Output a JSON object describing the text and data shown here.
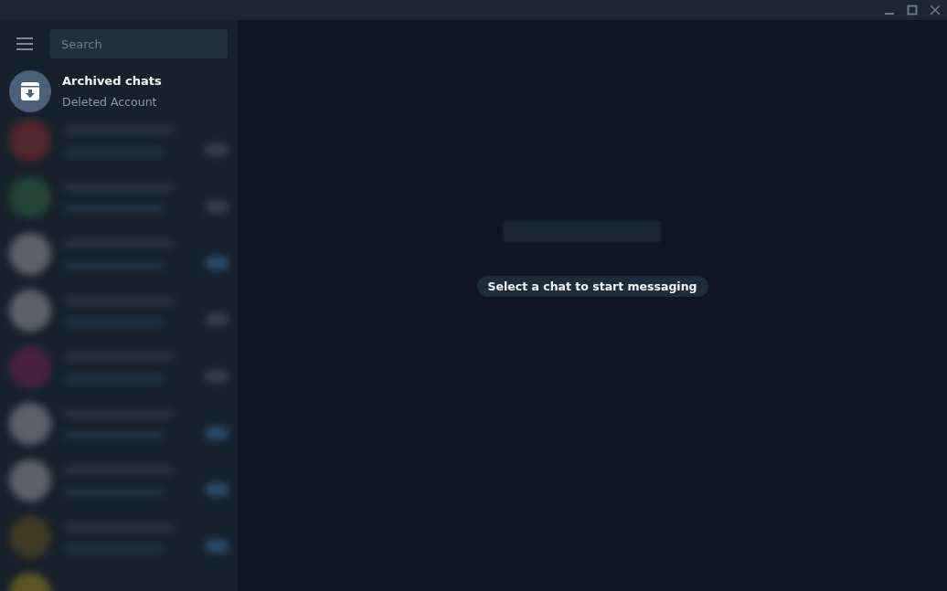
{
  "search": {
    "placeholder": "Search"
  },
  "archived": {
    "title": "Archived chats",
    "subtitle": "Deleted Account"
  },
  "blurred_chats": [
    {
      "muted": true
    },
    {
      "muted": true
    },
    {
      "muted": false
    },
    {
      "muted": true
    },
    {
      "muted": true
    },
    {
      "muted": false
    },
    {
      "muted": false
    },
    {
      "muted": false
    }
  ],
  "empty_state": {
    "hint": "Select a chat to start messaging"
  }
}
